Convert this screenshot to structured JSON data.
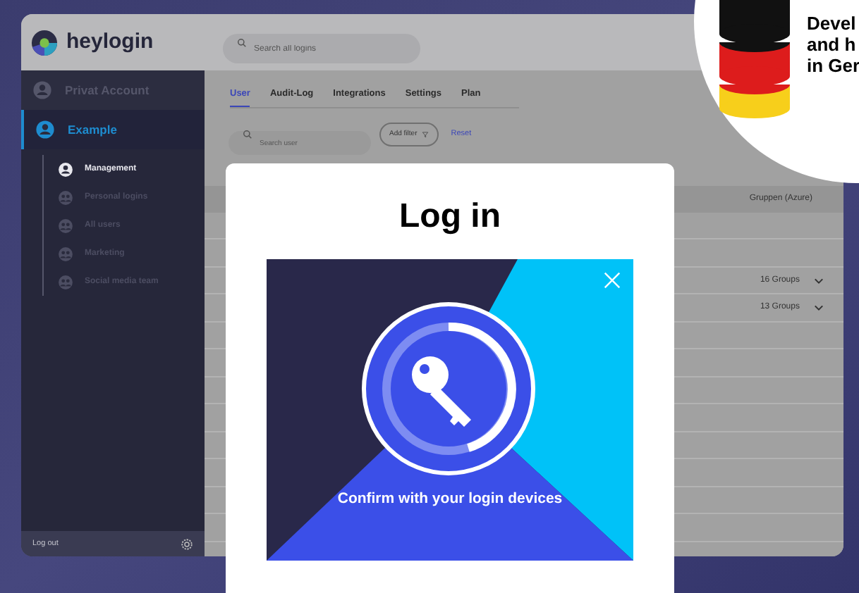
{
  "app": {
    "logo": "heylogin",
    "search": {
      "placeholder": "Search all logins"
    }
  },
  "sidebar": {
    "accounts": [
      {
        "label": "Privat Account",
        "selected": false
      },
      {
        "label": "Example",
        "selected": true,
        "children": [
          {
            "label": "Management",
            "selected": true
          },
          {
            "label": "Personal logins",
            "selected": false
          },
          {
            "label": "All users",
            "selected": false
          },
          {
            "label": "Marketing",
            "selected": false
          },
          {
            "label": "Social media team",
            "selected": false
          }
        ]
      }
    ],
    "logout": "Log out"
  },
  "tabs": [
    {
      "label": "User",
      "selected": true
    },
    {
      "label": "Audit-Log",
      "selected": false
    },
    {
      "label": "Integrations",
      "selected": false
    },
    {
      "label": "Settings",
      "selected": false
    },
    {
      "label": "Plan",
      "selected": false
    }
  ],
  "filter_bar": {
    "search": {
      "placeholder": "Search user"
    },
    "add_filter": "Add filter",
    "reset": "Reset"
  },
  "table": {
    "columns": [
      "Gruppen (Azure)"
    ],
    "rows": [
      {},
      {},
      {
        "groups": "16 Groups",
        "expanded": false
      },
      {
        "groups": "13 Groups",
        "expanded": false
      },
      {},
      {},
      {},
      {},
      {},
      {},
      {},
      {}
    ]
  },
  "dialog": {
    "title": "Log in",
    "message": "Confirm with your login devices"
  },
  "badge": {
    "lines": [
      "Devel",
      "and h",
      "in Ger"
    ]
  }
}
